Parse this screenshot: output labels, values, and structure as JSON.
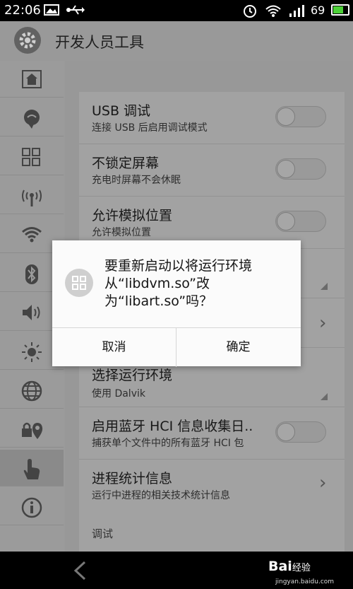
{
  "status_bar": {
    "time": "22:06",
    "battery_level": "69",
    "icons": [
      "image-icon",
      "usb-icon",
      "alarm-icon",
      "wifi-icon",
      "signal-icon",
      "battery-icon"
    ]
  },
  "app_bar": {
    "title": "开发人员工具",
    "icon": "gear-icon"
  },
  "sidebar": {
    "items": [
      {
        "icon": "home-icon"
      },
      {
        "icon": "chat-icon"
      },
      {
        "icon": "apps-grid-icon"
      },
      {
        "icon": "antenna-icon"
      },
      {
        "icon": "wifi-icon"
      },
      {
        "icon": "bluetooth-icon"
      },
      {
        "icon": "volume-icon"
      },
      {
        "icon": "brightness-icon"
      },
      {
        "icon": "globe-icon"
      },
      {
        "icon": "lock-location-icon"
      },
      {
        "icon": "hand-icon",
        "active": true
      },
      {
        "icon": "info-icon"
      }
    ]
  },
  "settings": {
    "rows": [
      {
        "title": "USB 调试",
        "subtitle": "连接 USB 后启用调试模式",
        "control": "toggle",
        "on": false
      },
      {
        "title": "不锁定屏幕",
        "subtitle": "充电时屏幕不会休眠",
        "control": "toggle",
        "on": false
      },
      {
        "title": "允许模拟位置",
        "subtitle": "允许模拟位置",
        "control": "toggle",
        "on": false
      },
      {
        "title": "",
        "subtitle": "",
        "control": "dropdown"
      },
      {
        "title": "",
        "subtitle": "",
        "control": "chevron"
      },
      {
        "title": "选择运行环境",
        "subtitle": "使用 Dalvik",
        "control": "dropdown"
      },
      {
        "title": "启用蓝牙 HCI 信息收集日..",
        "subtitle": "捕获单个文件中的所有蓝牙 HCI 包",
        "control": "toggle",
        "on": false
      },
      {
        "title": "进程统计信息",
        "subtitle": "运行中进程的相关技术统计信息",
        "control": "chevron"
      }
    ],
    "section_label": "调试"
  },
  "dialog": {
    "message": "要重新启动以将运行环境从“libdvm.so”改为“libart.so”吗？",
    "cancel_label": "取消",
    "confirm_label": "确定"
  },
  "nav_bar": {
    "back_icon": "back-arrow-icon",
    "watermark_brand": "Bai",
    "watermark_suffix": "经验",
    "watermark_url": "jingyan.baidu.com"
  },
  "colors": {
    "battery_fill": "#4cd137",
    "dim_overlay": "#9a9a9a",
    "dialog_bg": "#fbfbfb"
  }
}
